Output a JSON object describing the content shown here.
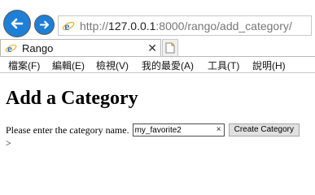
{
  "browser": {
    "url_scheme": "http://",
    "url_host": "127.0.0.1",
    "url_rest": ":8000/rango/add_category/",
    "tab_title": "Rango",
    "tab_close_glyph": "✕",
    "icons": {
      "back": "back-arrow-icon",
      "forward": "forward-arrow-icon",
      "site": "ie-e-icon",
      "new_tab": "new-tab-icon"
    },
    "accent_color": "#1e7fd6"
  },
  "menubar": {
    "items": [
      {
        "label": "檔案(F)"
      },
      {
        "label": "編輯(E)"
      },
      {
        "label": "檢視(V)"
      },
      {
        "label": "我的最愛(A)"
      },
      {
        "label": "工具(T)"
      },
      {
        "label": "說明(H)"
      }
    ]
  },
  "page": {
    "title": "Add a Category",
    "prompt": "Please enter the category name.",
    "name_value": "my_favorite2",
    "clear_glyph": "×",
    "submit_label": "Create Category",
    "trailing": ">"
  }
}
